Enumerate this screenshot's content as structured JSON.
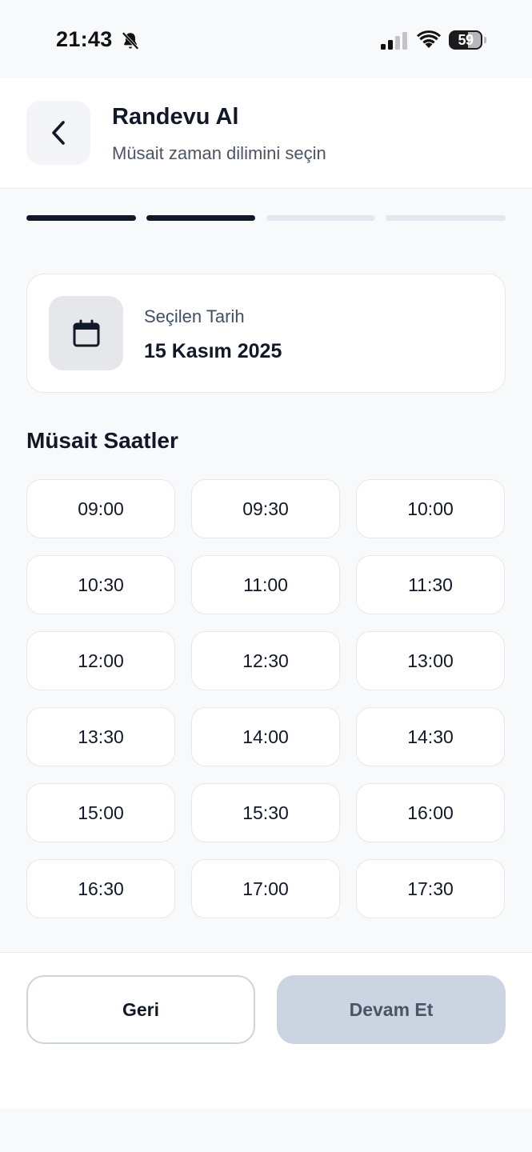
{
  "status_bar": {
    "time": "21:43",
    "battery": "59"
  },
  "header": {
    "title": "Randevu Al",
    "subtitle": "Müsait zaman dilimini seçin"
  },
  "progress": {
    "total_steps": 4,
    "completed_steps": 2,
    "active_color": "#111827",
    "inactive_color": "#e2e8f0"
  },
  "selected_date": {
    "label": "Seçilen Tarih",
    "value": "15 Kasım 2025"
  },
  "slots_section": {
    "title": "Müsait Saatler",
    "times": [
      "09:00",
      "09:30",
      "10:00",
      "10:30",
      "11:00",
      "11:30",
      "12:00",
      "12:30",
      "13:00",
      "13:30",
      "14:00",
      "14:30",
      "15:00",
      "15:30",
      "16:00",
      "16:30",
      "17:00",
      "17:30"
    ]
  },
  "footer": {
    "back_label": "Geri",
    "continue_label": "Devam Et"
  }
}
